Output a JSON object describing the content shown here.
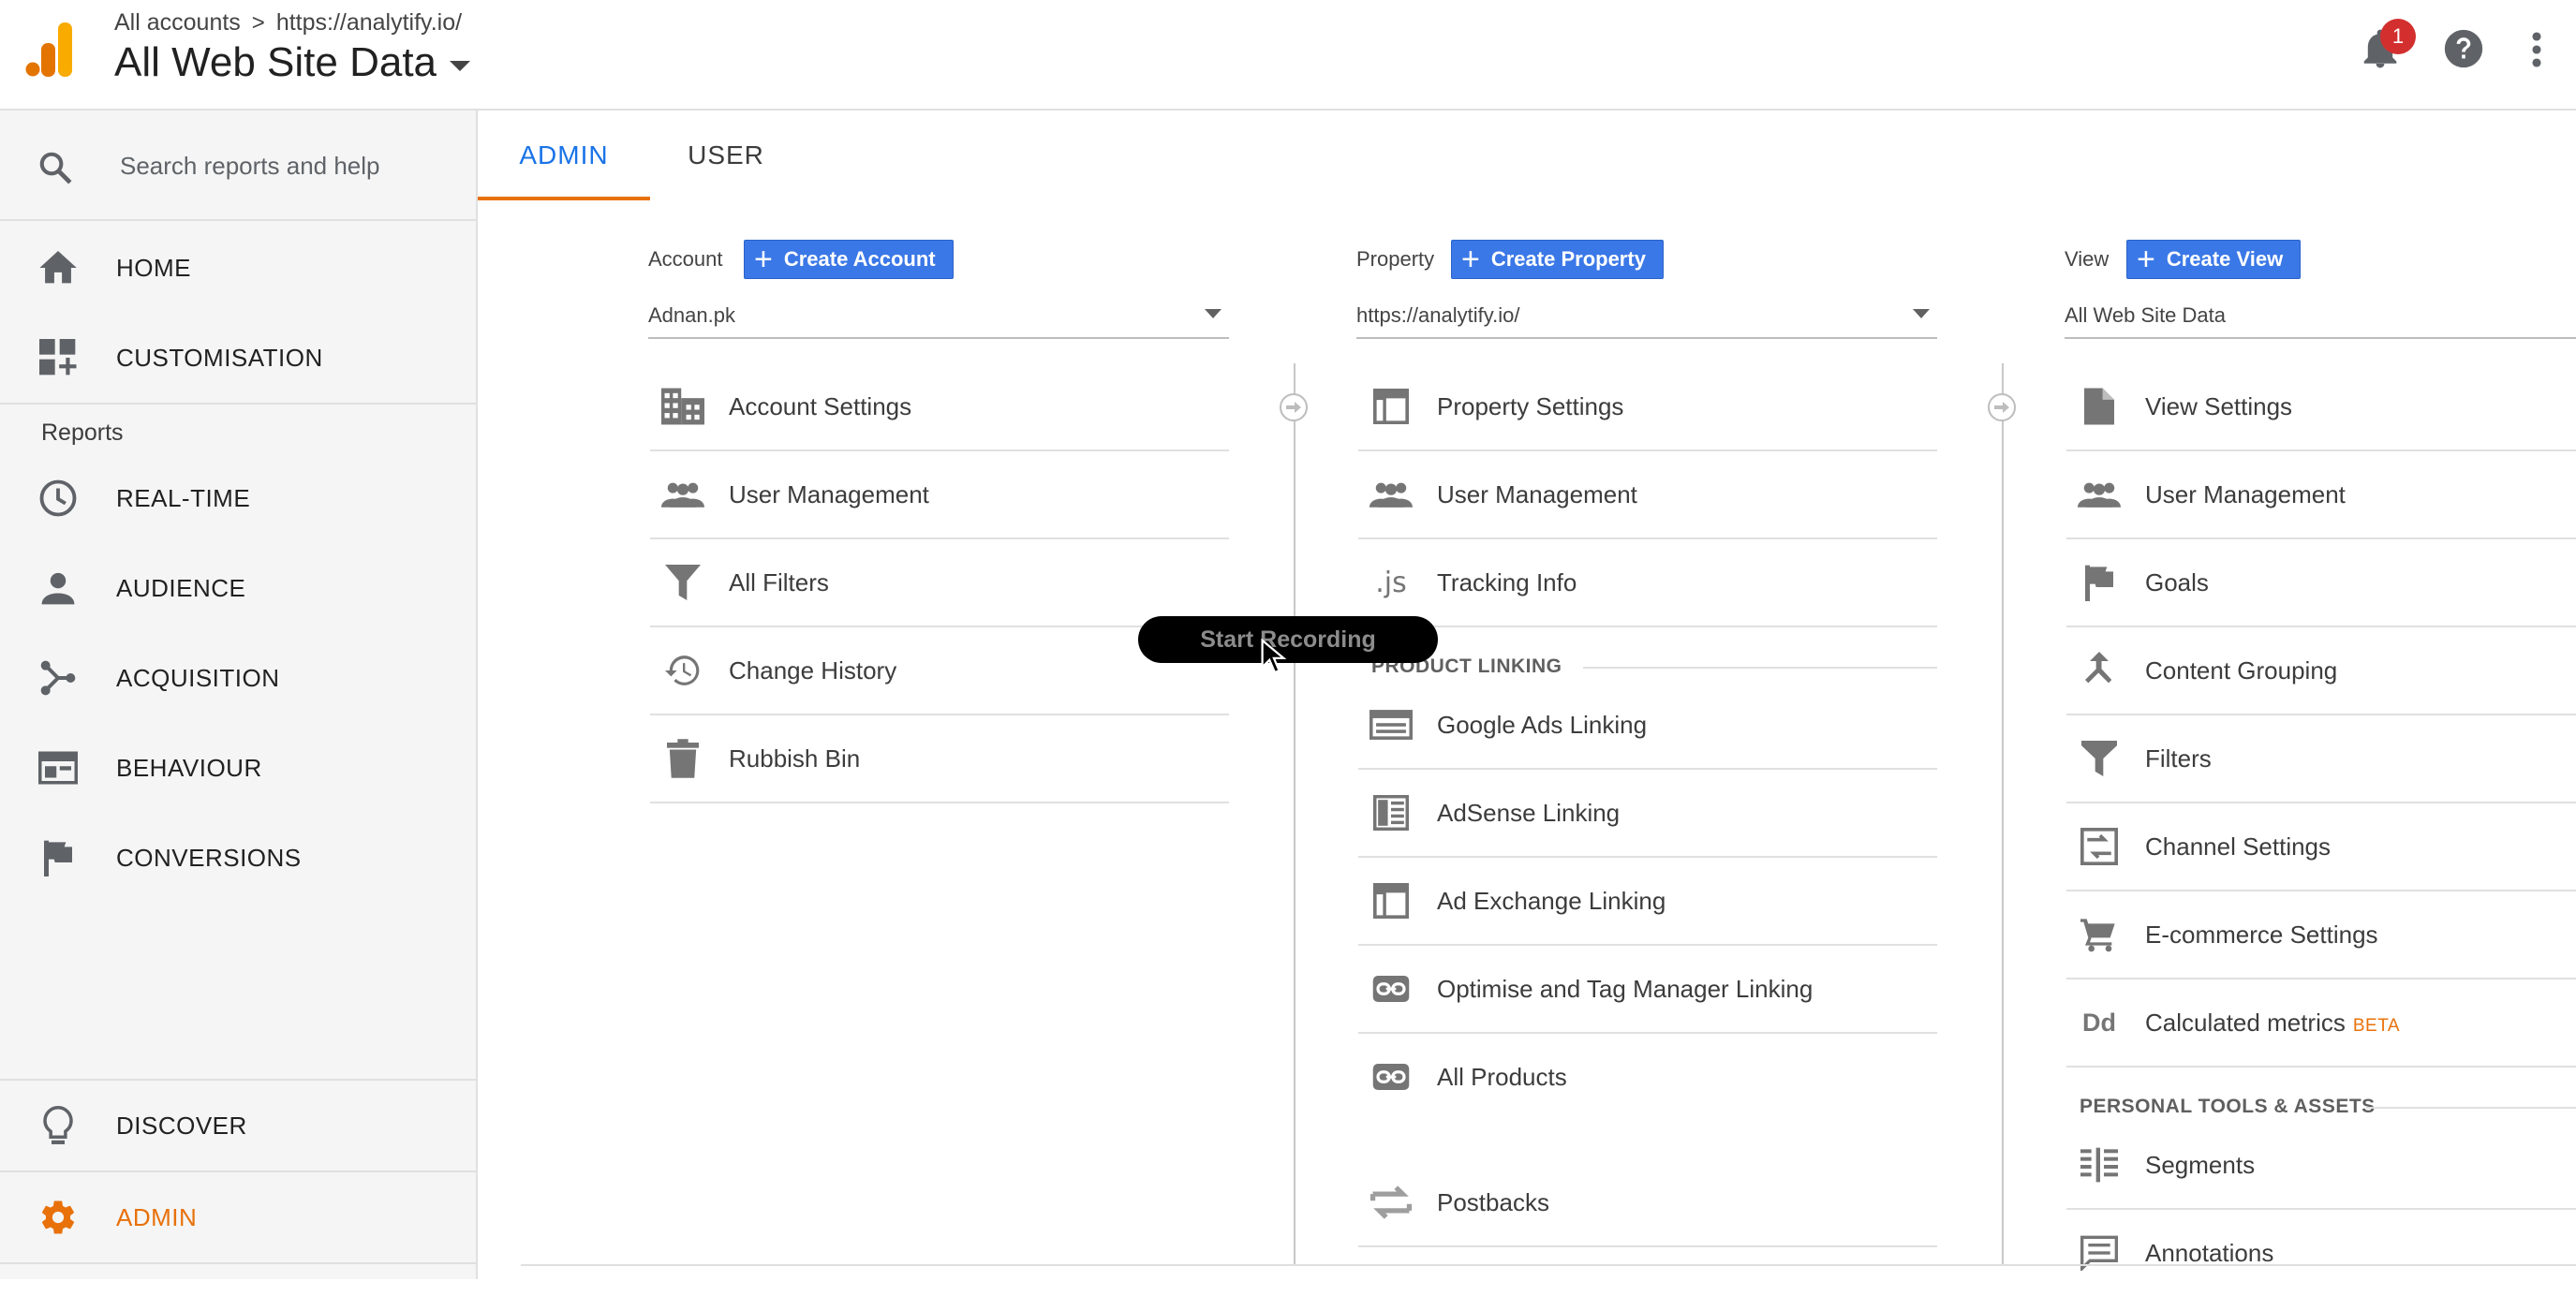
{
  "header": {
    "breadcrumb_root": "All accounts",
    "breadcrumb_separator": ">",
    "breadcrumb_property": "https://analytify.io/",
    "view_title": "All Web Site Data",
    "notification_count": "1"
  },
  "search": {
    "placeholder": "Search reports and help"
  },
  "sidebar": {
    "home": "HOME",
    "customisation": "CUSTOMISATION",
    "reports_heading": "Reports",
    "realtime": "REAL-TIME",
    "audience": "AUDIENCE",
    "acquisition": "ACQUISITION",
    "behaviour": "BEHAVIOUR",
    "conversions": "CONVERSIONS",
    "discover": "DISCOVER",
    "admin": "ADMIN"
  },
  "tabs": {
    "admin": "ADMIN",
    "user": "USER"
  },
  "account": {
    "label": "Account",
    "create": "Create Account",
    "selected": "Adnan.pk",
    "items": [
      "Account Settings",
      "User Management",
      "All Filters",
      "Change History",
      "Rubbish Bin"
    ]
  },
  "property": {
    "label": "Property",
    "create": "Create Property",
    "selected": "https://analytify.io/",
    "items": [
      "Property Settings",
      "User Management",
      "Tracking Info"
    ],
    "product_linking_heading": "PRODUCT LINKING",
    "linking_items": [
      "Google Ads Linking",
      "AdSense Linking",
      "Ad Exchange Linking",
      "Optimise and Tag Manager Linking",
      "All Products"
    ],
    "postbacks": "Postbacks"
  },
  "view": {
    "label": "View",
    "create": "Create View",
    "selected": "All Web Site Data",
    "items": [
      "View Settings",
      "User Management",
      "Goals",
      "Content Grouping",
      "Filters",
      "Channel Settings",
      "E-commerce Settings",
      "Calculated metrics"
    ],
    "beta_badge": "BETA",
    "personal_heading": "PERSONAL TOOLS & ASSETS",
    "personal_items": [
      "Segments",
      "Annotations"
    ]
  },
  "recording_button": "Start Recording",
  "colors": {
    "accent_orange": "#e8710a",
    "link_blue": "#1a73e8",
    "button_blue": "#3b78e7",
    "badge_red": "#d32f2f"
  }
}
